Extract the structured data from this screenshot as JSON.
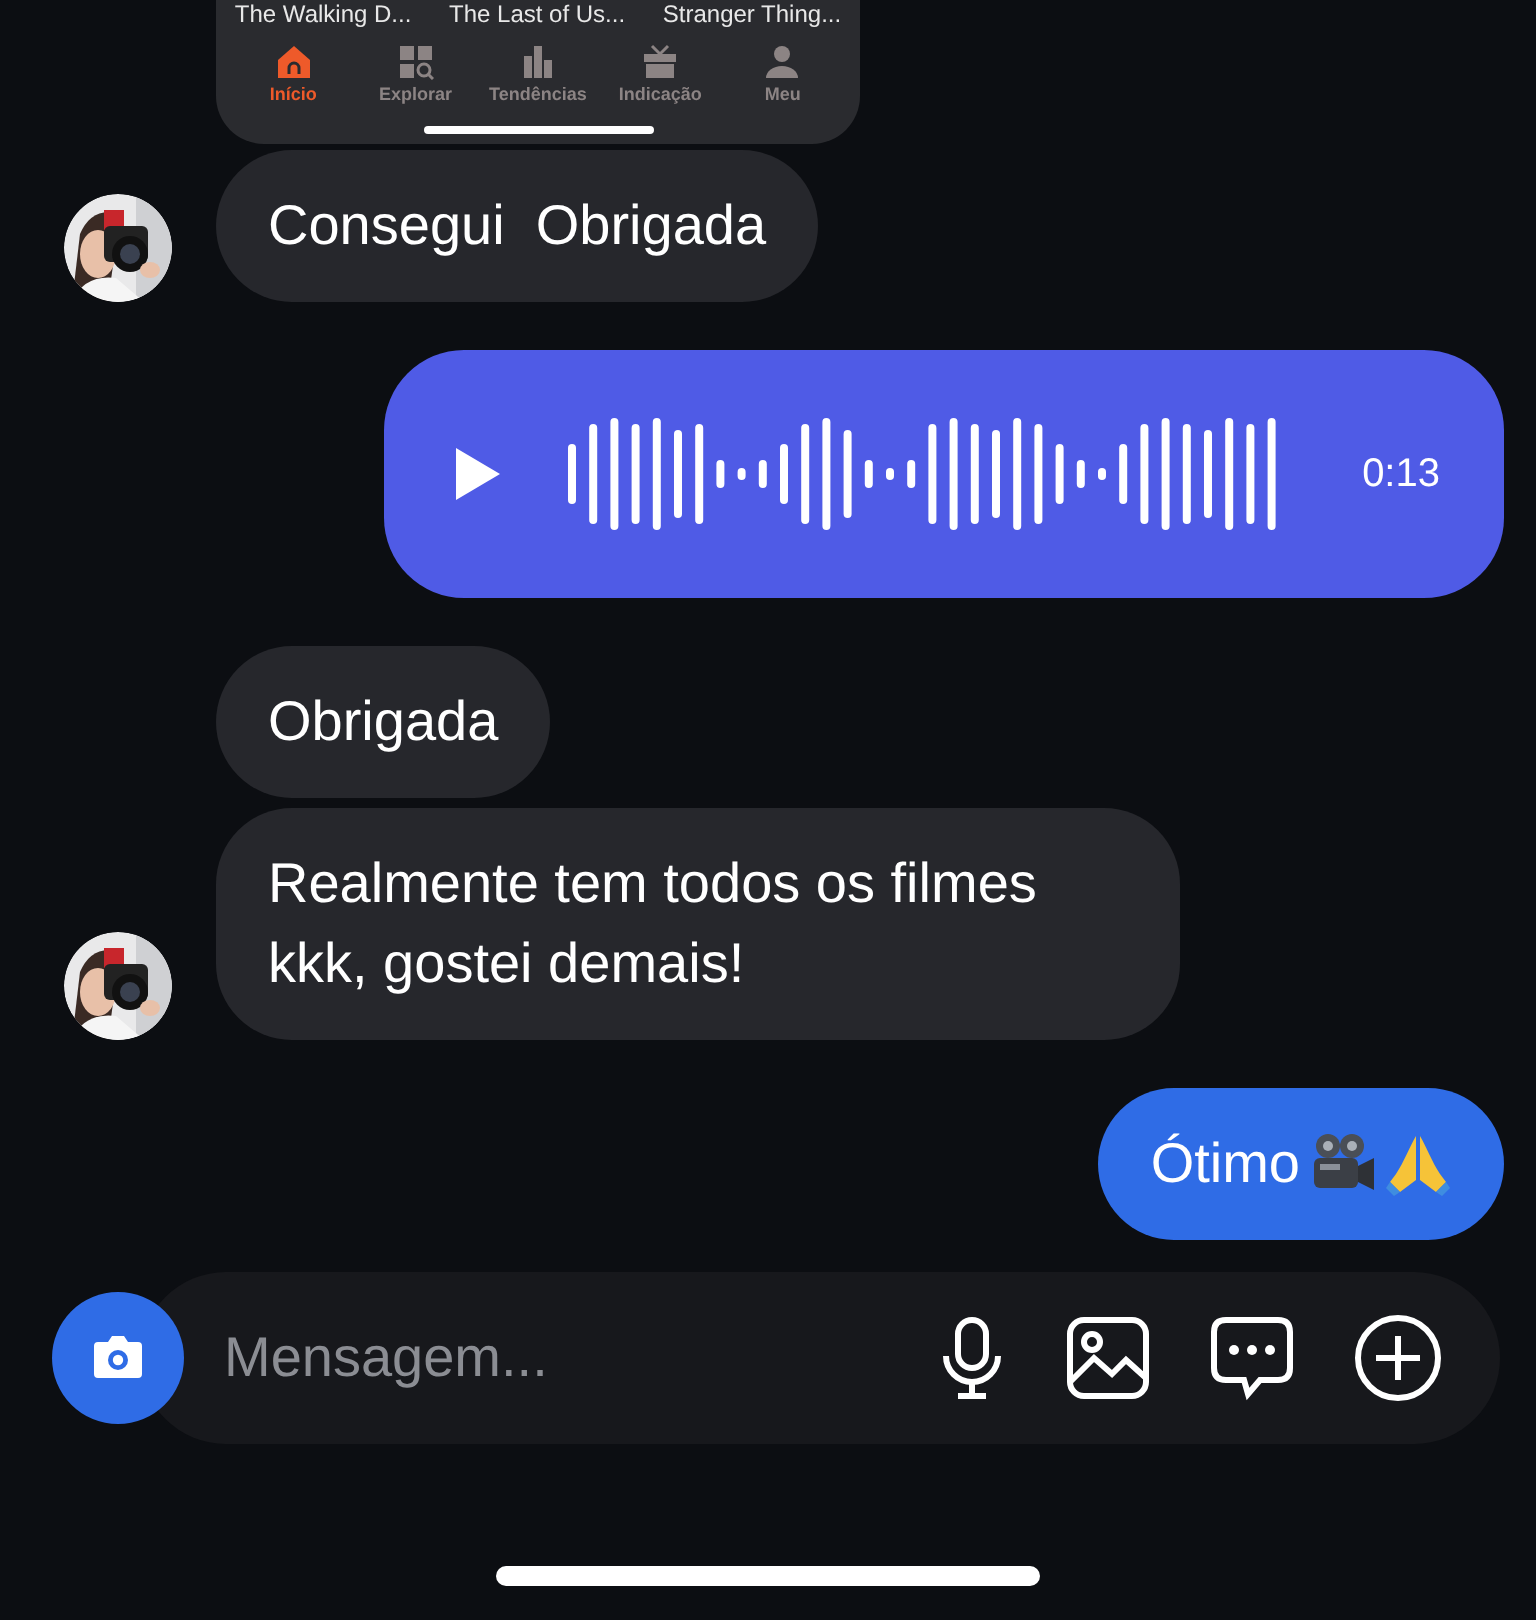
{
  "shared_screenshot": {
    "titles": [
      "The Walking D...",
      "The Last of Us...",
      "Stranger Thing..."
    ],
    "tabs": [
      {
        "label": "Início",
        "selected": true
      },
      {
        "label": "Explorar",
        "selected": false
      },
      {
        "label": "Tendências",
        "selected": false
      },
      {
        "label": "Indicação",
        "selected": false
      },
      {
        "label": "Meu",
        "selected": false
      }
    ]
  },
  "messages": [
    {
      "kind": "received",
      "avatar": true,
      "text": "Consegui  Obrigada"
    },
    {
      "kind": "voice",
      "duration": "0:13"
    },
    {
      "kind": "received",
      "avatar": false,
      "text": "Obrigada"
    },
    {
      "kind": "received",
      "avatar": true,
      "text": "Realmente tem todos os filmes kkk, gostei demais!"
    },
    {
      "kind": "emoji",
      "text": "Ótimo"
    }
  ],
  "composer": {
    "placeholder": "Mensagem..."
  }
}
